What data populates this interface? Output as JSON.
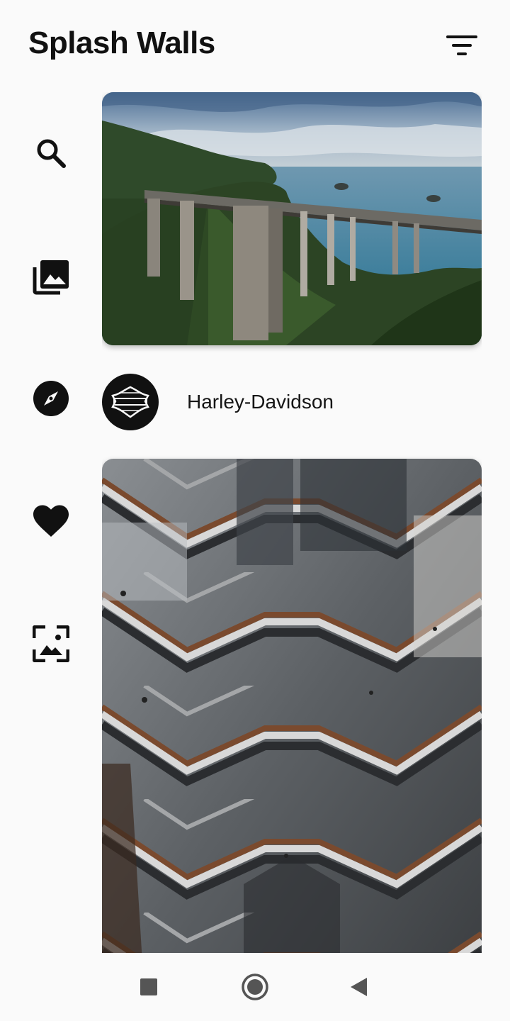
{
  "app": {
    "title": "Splash Walls"
  },
  "toolbar": {
    "filter_icon": "filter-list-icon"
  },
  "rail": {
    "items": [
      {
        "icon": "search-icon"
      },
      {
        "icon": "photo-library-icon"
      },
      {
        "icon": "explore-icon"
      },
      {
        "icon": "favorite-icon"
      },
      {
        "icon": "wallpaper-icon"
      }
    ]
  },
  "feed": {
    "collection": {
      "name": "Harley-Davidson",
      "avatar_icon": "harley-davidson-logo"
    },
    "photos": [
      {
        "subject": "bridge-photo"
      },
      {
        "subject": "staircase-photo"
      }
    ]
  },
  "navbar": {
    "buttons": [
      {
        "icon": "recents-square-icon"
      },
      {
        "icon": "home-circle-icon"
      },
      {
        "icon": "back-triangle-icon"
      }
    ]
  },
  "colors": {
    "background": "#fafafa",
    "icon": "#111111",
    "text": "#151515",
    "nav_icon": "#555555"
  }
}
